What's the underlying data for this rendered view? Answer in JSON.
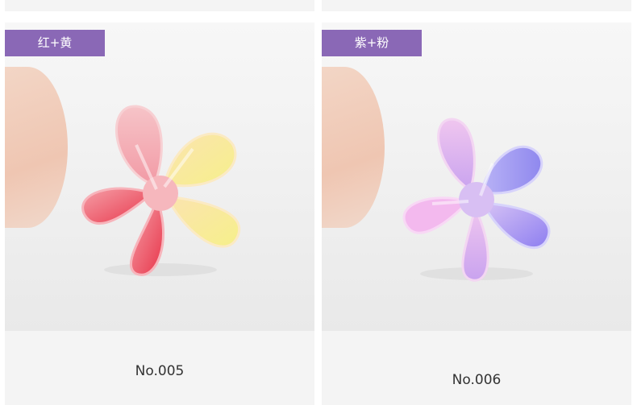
{
  "products": [
    {
      "badge": "红+黄",
      "caption": "No.005"
    },
    {
      "badge": "紫+粉",
      "caption": "No.006"
    }
  ],
  "colors": {
    "badge_bg": "#8a68b6",
    "card_bg": "#f4f4f4",
    "caption_text": "#333333"
  }
}
